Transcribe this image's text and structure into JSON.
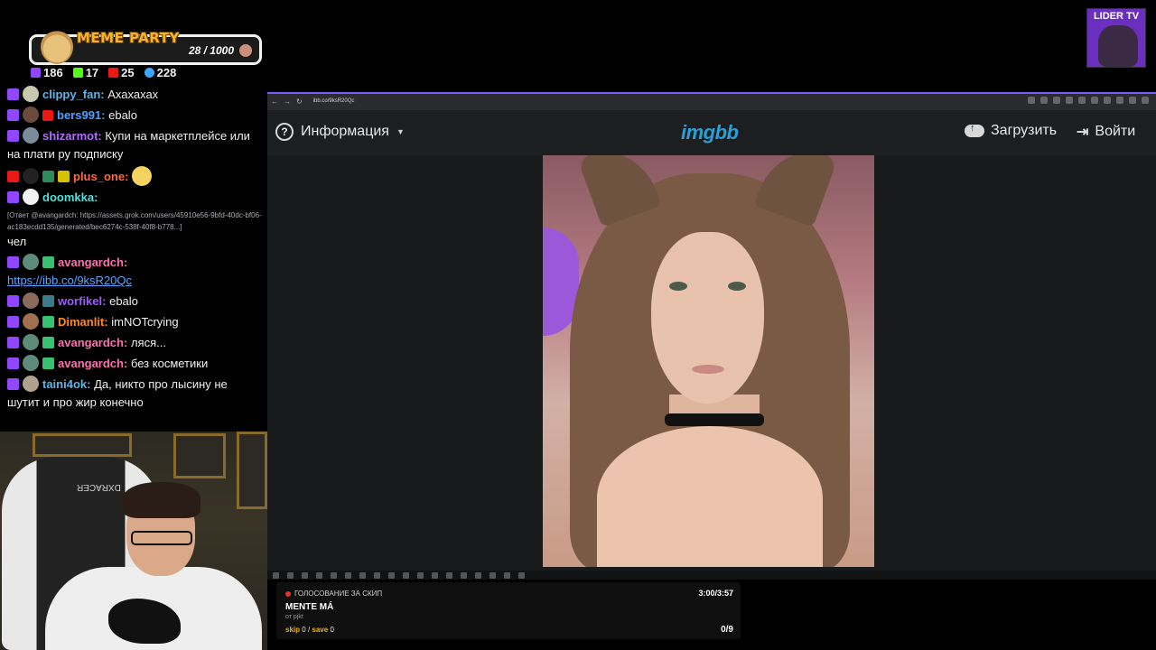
{
  "meme_party": {
    "title": "MEME PARTY",
    "count": "28 / 1000"
  },
  "stats": {
    "twitch": "186",
    "kick": "17",
    "live": "25",
    "viewers": "228"
  },
  "chat": {
    "messages": [
      {
        "user": "clippy_fan:",
        "text": "Ахахахах",
        "color": "#5fb4e8"
      },
      {
        "user": "bers991:",
        "text": "ebalo",
        "color": "#4fa0ff"
      },
      {
        "user": "shizarmot:",
        "text": "Купи на маркетплейсе или на плати ру подписку",
        "color": "#b36bff"
      },
      {
        "user": "plus_one:",
        "text": "",
        "color": "#ff6a3d"
      },
      {
        "user": "doomkka:",
        "text": "",
        "color": "#4fe0d8"
      },
      {
        "reply": "[Ответ @avangardch: https://assets.grok.com/users/45910e56-9bfd-40dc-bf06-ac183ecdd135/generated/bec6274c-538f-40f8-b778...]",
        "text": "чел"
      },
      {
        "user": "avangardch:",
        "link": "https://ibb.co/9ksR20Qc",
        "color": "#ff6fb0"
      },
      {
        "user": "worfikel:",
        "text": "ebalo",
        "color": "#9c5cff"
      },
      {
        "user": "Dimanlit:",
        "text": "imNOTcrying",
        "color": "#ff8c1a"
      },
      {
        "user": "avangardch:",
        "text": "ляся...",
        "color": "#ff6fb0"
      },
      {
        "user": "avangardch:",
        "text": "без косметики",
        "color": "#ff6fb0"
      },
      {
        "user": "taini4ok:",
        "text": "Да, никто про лысину не шутит и про жир конечно",
        "color": "#5fb4e8"
      }
    ]
  },
  "webcam": {
    "chair_brand": "DXRACER"
  },
  "channel_logo": {
    "label": "LIDER TV"
  },
  "browser": {
    "url": "ibb.co/9ksR20Qc",
    "site_logo": "imgbb",
    "info_label": "Информация",
    "upload_label": "Загрузить",
    "login_label": "Войти"
  },
  "skip_widget": {
    "header": "ГОЛОСОВАНИЕ ЗА СКИП",
    "time": "3:00/3:57",
    "song": "MENTE MÁ",
    "from": "от pjkt",
    "skip_label": "skip",
    "skip_count": "0",
    "save_label": "save",
    "save_count": "0",
    "tally": "0/9"
  }
}
